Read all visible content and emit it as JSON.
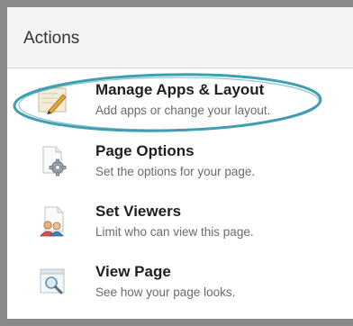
{
  "panel": {
    "title": "Actions"
  },
  "actions": [
    {
      "label": "Manage Apps & Layout",
      "description": "Add apps or change your layout.",
      "icon": "layout-edit-icon"
    },
    {
      "label": "Page Options",
      "description": "Set the options for your page.",
      "icon": "page-settings-icon"
    },
    {
      "label": "Set Viewers",
      "description": "Limit who can view this page.",
      "icon": "page-viewers-icon"
    },
    {
      "label": "View Page",
      "description": "See how your page looks.",
      "icon": "page-preview-icon"
    }
  ],
  "colors": {
    "highlight_ring": "#3f9fb0",
    "frame_border": "#8a8a8a",
    "header_bg": "#f4f4f4"
  }
}
